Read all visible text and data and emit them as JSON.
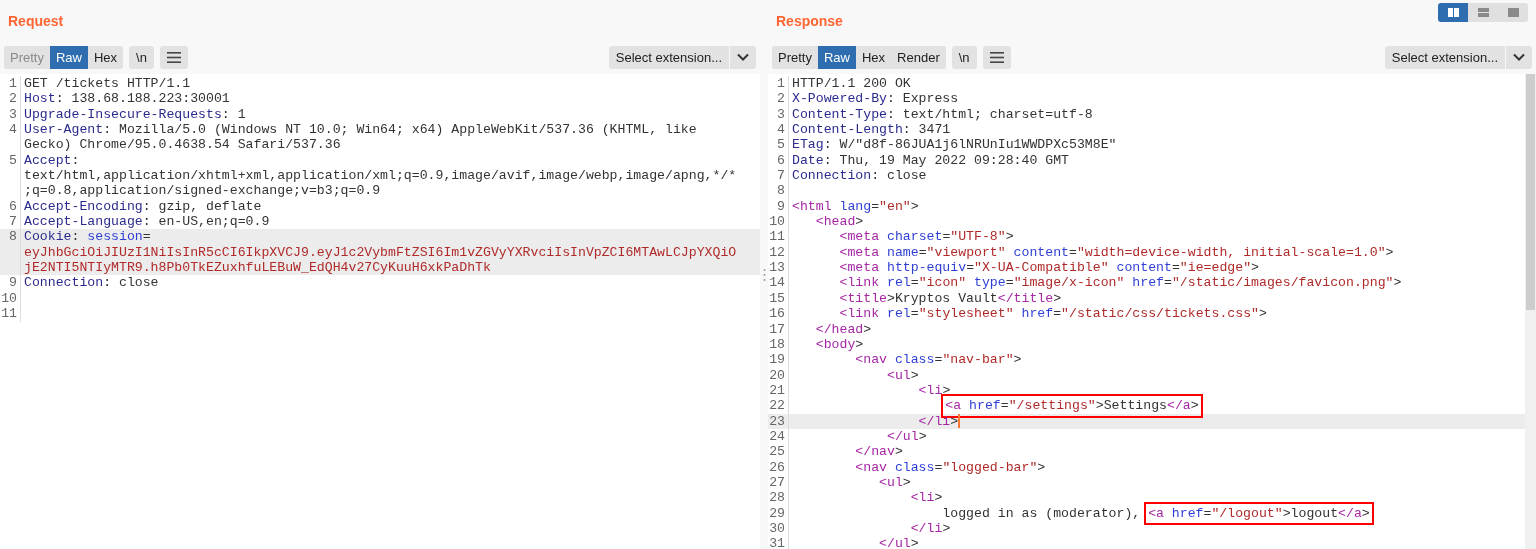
{
  "layout_buttons": [
    {
      "kind": "side-by-side",
      "selected": true
    },
    {
      "kind": "stacked",
      "selected": false
    },
    {
      "kind": "single",
      "selected": false
    }
  ],
  "panes": [
    {
      "title": "Request",
      "tabs": [
        {
          "label": "Pretty",
          "selected": false,
          "disabled": true
        },
        {
          "label": "Raw",
          "selected": true,
          "disabled": false
        },
        {
          "label": "Hex",
          "selected": false,
          "disabled": false
        }
      ],
      "newline_button": "\\n",
      "extension_select": "Select extension...",
      "scrollbar": false,
      "lines": [
        {
          "number": "1",
          "rows": [
            [
              {
                "kind": "text",
                "text": "GET /tickets HTTP/1.1"
              }
            ]
          ]
        },
        {
          "number": "2",
          "rows": [
            [
              {
                "kind": "name",
                "text": "Host"
              },
              {
                "kind": "text",
                "text": ": 138.68.188.223:30001"
              }
            ]
          ]
        },
        {
          "number": "3",
          "rows": [
            [
              {
                "kind": "name",
                "text": "Upgrade-Insecure-Requests"
              },
              {
                "kind": "text",
                "text": ": 1"
              }
            ]
          ]
        },
        {
          "number": "4",
          "rows": [
            [
              {
                "kind": "name",
                "text": "User-Agent"
              },
              {
                "kind": "text",
                "text": ": Mozilla/5.0 (Windows NT 10.0; Win64; x64) AppleWebKit/537.36 (KHTML, like"
              }
            ],
            [
              {
                "kind": "text",
                "text": "Gecko) Chrome/95.0.4638.54 Safari/537.36"
              }
            ]
          ]
        },
        {
          "number": "5",
          "rows": [
            [
              {
                "kind": "name",
                "text": "Accept"
              },
              {
                "kind": "text",
                "text": ":"
              }
            ],
            [
              {
                "kind": "text",
                "text": "text/html,application/xhtml+xml,application/xml;q=0.9,image/avif,image/webp,image/apng,*/*"
              }
            ],
            [
              {
                "kind": "text",
                "text": ";q=0.8,application/signed-exchange;v=b3;q=0.9"
              }
            ]
          ]
        },
        {
          "number": "6",
          "rows": [
            [
              {
                "kind": "name",
                "text": "Accept-Encoding"
              },
              {
                "kind": "text",
                "text": ": gzip, deflate"
              }
            ]
          ]
        },
        {
          "number": "7",
          "rows": [
            [
              {
                "kind": "name",
                "text": "Accept-Language"
              },
              {
                "kind": "text",
                "text": ": en-US,en;q=0.9"
              }
            ]
          ]
        },
        {
          "number": "8",
          "highlighted": true,
          "rows": [
            [
              {
                "kind": "name",
                "text": "Cookie"
              },
              {
                "kind": "text",
                "text": ":"
              },
              {
                "kind": "attr",
                "text": " session"
              },
              {
                "kind": "text",
                "text": "="
              }
            ],
            [
              {
                "kind": "string",
                "text": "eyJhbGciOiJIUzI1NiIsInR5cCI6IkpXVCJ9.eyJ1c2VybmFtZSI6Im1vZGVyYXRvciIsInVpZCI6MTAwLCJpYXQiO"
              }
            ],
            [
              {
                "kind": "string",
                "text": "jE2NTI5NTIyMTR9.h8Pb0TkEZuxhfuLEBuW_EdQH4v27CyKuuH6xkPaDhTk"
              }
            ]
          ]
        },
        {
          "number": "9",
          "rows": [
            [
              {
                "kind": "name",
                "text": "Connection"
              },
              {
                "kind": "text",
                "text": ": close"
              }
            ]
          ]
        },
        {
          "number": "10"
        },
        {
          "number": "11"
        }
      ]
    },
    {
      "title": "Response",
      "tabs": [
        {
          "label": "Pretty",
          "selected": false,
          "disabled": false
        },
        {
          "label": "Raw",
          "selected": true,
          "disabled": false
        },
        {
          "label": "Hex",
          "selected": false,
          "disabled": false
        },
        {
          "label": "Render",
          "selected": false,
          "disabled": false
        }
      ],
      "newline_button": "\\n",
      "extension_select": "Select extension...",
      "scrollbar": true,
      "lines": [
        {
          "number": "1",
          "rows": [
            [
              {
                "kind": "text",
                "text": "HTTP/1.1 200 OK"
              }
            ]
          ]
        },
        {
          "number": "2",
          "rows": [
            [
              {
                "kind": "name",
                "text": "X-Powered-By"
              },
              {
                "kind": "text",
                "text": ": Express"
              }
            ]
          ]
        },
        {
          "number": "3",
          "rows": [
            [
              {
                "kind": "name",
                "text": "Content-Type"
              },
              {
                "kind": "text",
                "text": ": text/html; charset=utf-8"
              }
            ]
          ]
        },
        {
          "number": "4",
          "rows": [
            [
              {
                "kind": "name",
                "text": "Content-Length"
              },
              {
                "kind": "text",
                "text": ": 3471"
              }
            ]
          ]
        },
        {
          "number": "5",
          "rows": [
            [
              {
                "kind": "name",
                "text": "ETag"
              },
              {
                "kind": "text",
                "text": ": W/\"d8f-86JUA1j6lNRUnIu1WWDPXc53M8E\""
              }
            ]
          ]
        },
        {
          "number": "6",
          "rows": [
            [
              {
                "kind": "name",
                "text": "Date"
              },
              {
                "kind": "text",
                "text": ": Thu, 19 May 2022 09:28:40 GMT"
              }
            ]
          ]
        },
        {
          "number": "7",
          "rows": [
            [
              {
                "kind": "name",
                "text": "Connection"
              },
              {
                "kind": "text",
                "text": ": close"
              }
            ]
          ]
        },
        {
          "number": "8"
        },
        {
          "number": "9",
          "rows": [
            [
              {
                "kind": "tag",
                "text": "<html"
              },
              {
                "kind": "attr",
                "text": " lang"
              },
              {
                "kind": "text",
                "text": "="
              },
              {
                "kind": "string",
                "text": "\"en\""
              },
              {
                "kind": "text",
                "text": ">"
              }
            ]
          ]
        },
        {
          "number": "10",
          "rows": [
            [
              {
                "kind": "tag",
                "text": "   <head"
              },
              {
                "kind": "text",
                "text": ">"
              }
            ]
          ]
        },
        {
          "number": "11",
          "rows": [
            [
              {
                "kind": "tag",
                "text": "      <meta"
              },
              {
                "kind": "attr",
                "text": " charset"
              },
              {
                "kind": "text",
                "text": "="
              },
              {
                "kind": "string",
                "text": "\"UTF-8\""
              },
              {
                "kind": "text",
                "text": ">"
              }
            ]
          ]
        },
        {
          "number": "12",
          "rows": [
            [
              {
                "kind": "tag",
                "text": "      <meta"
              },
              {
                "kind": "attr",
                "text": " name"
              },
              {
                "kind": "text",
                "text": "="
              },
              {
                "kind": "string",
                "text": "\"viewport\""
              },
              {
                "kind": "attr",
                "text": " content"
              },
              {
                "kind": "text",
                "text": "="
              },
              {
                "kind": "string",
                "text": "\"width=device-width, initial-scale=1.0\""
              },
              {
                "kind": "text",
                "text": ">"
              }
            ]
          ]
        },
        {
          "number": "13",
          "rows": [
            [
              {
                "kind": "tag",
                "text": "      <meta"
              },
              {
                "kind": "attr",
                "text": " http-equiv"
              },
              {
                "kind": "text",
                "text": "="
              },
              {
                "kind": "string",
                "text": "\"X-UA-Compatible\""
              },
              {
                "kind": "attr",
                "text": " content"
              },
              {
                "kind": "text",
                "text": "="
              },
              {
                "kind": "string",
                "text": "\"ie=edge\""
              },
              {
                "kind": "text",
                "text": ">"
              }
            ]
          ]
        },
        {
          "number": "14",
          "rows": [
            [
              {
                "kind": "tag",
                "text": "      <link"
              },
              {
                "kind": "attr",
                "text": " rel"
              },
              {
                "kind": "text",
                "text": "="
              },
              {
                "kind": "string",
                "text": "\"icon\""
              },
              {
                "kind": "attr",
                "text": " type"
              },
              {
                "kind": "text",
                "text": "="
              },
              {
                "kind": "string",
                "text": "\"image/x-icon\""
              },
              {
                "kind": "attr",
                "text": " href"
              },
              {
                "kind": "text",
                "text": "="
              },
              {
                "kind": "string",
                "text": "\"/static/images/favicon.png\""
              },
              {
                "kind": "text",
                "text": ">"
              }
            ]
          ]
        },
        {
          "number": "15",
          "rows": [
            [
              {
                "kind": "tag",
                "text": "      <title"
              },
              {
                "kind": "text",
                "text": ">Kryptos Vault"
              },
              {
                "kind": "tag",
                "text": "</title"
              },
              {
                "kind": "text",
                "text": ">"
              }
            ]
          ]
        },
        {
          "number": "16",
          "rows": [
            [
              {
                "kind": "tag",
                "text": "      <link"
              },
              {
                "kind": "attr",
                "text": " rel"
              },
              {
                "kind": "text",
                "text": "="
              },
              {
                "kind": "string",
                "text": "\"stylesheet\""
              },
              {
                "kind": "attr",
                "text": " href"
              },
              {
                "kind": "text",
                "text": "="
              },
              {
                "kind": "string",
                "text": "\"/static/css/tickets.css\""
              },
              {
                "kind": "text",
                "text": ">"
              }
            ]
          ]
        },
        {
          "number": "17",
          "rows": [
            [
              {
                "kind": "tag",
                "text": "   </head"
              },
              {
                "kind": "text",
                "text": ">"
              }
            ]
          ]
        },
        {
          "number": "18",
          "rows": [
            [
              {
                "kind": "tag",
                "text": "   <body"
              },
              {
                "kind": "text",
                "text": ">"
              }
            ]
          ]
        },
        {
          "number": "19",
          "rows": [
            [
              {
                "kind": "tag",
                "text": "        <nav"
              },
              {
                "kind": "attr",
                "text": " class"
              },
              {
                "kind": "text",
                "text": "="
              },
              {
                "kind": "string",
                "text": "\"nav-bar\""
              },
              {
                "kind": "text",
                "text": ">"
              }
            ]
          ]
        },
        {
          "number": "20",
          "rows": [
            [
              {
                "kind": "tag",
                "text": "            <ul"
              },
              {
                "kind": "text",
                "text": ">"
              }
            ]
          ]
        },
        {
          "number": "21",
          "rows": [
            [
              {
                "kind": "tag",
                "text": "                <li"
              },
              {
                "kind": "text",
                "text": ">"
              }
            ]
          ]
        },
        {
          "number": "22",
          "callout": [
            {
              "kind": "tag",
              "text": "<a"
            },
            {
              "kind": "attr",
              "text": " href"
            },
            {
              "kind": "text",
              "text": "="
            },
            {
              "kind": "string",
              "text": "\"/settings\""
            },
            {
              "kind": "text",
              "text": ">Settings"
            },
            {
              "kind": "tag",
              "text": "</a"
            },
            {
              "kind": "text",
              "text": ">"
            }
          ]
        },
        {
          "number": "23",
          "highlighted": true,
          "caret": true,
          "rows": [
            [
              {
                "kind": "tag",
                "text": "                </li"
              },
              {
                "kind": "text",
                "text": ">"
              }
            ]
          ]
        },
        {
          "number": "24",
          "rows": [
            [
              {
                "kind": "tag",
                "text": "            </ul"
              },
              {
                "kind": "text",
                "text": ">"
              }
            ]
          ]
        },
        {
          "number": "25",
          "rows": [
            [
              {
                "kind": "tag",
                "text": "        </nav"
              },
              {
                "kind": "text",
                "text": ">"
              }
            ]
          ]
        },
        {
          "number": "26",
          "rows": [
            [
              {
                "kind": "tag",
                "text": "        <nav"
              },
              {
                "kind": "attr",
                "text": " class"
              },
              {
                "kind": "text",
                "text": "="
              },
              {
                "kind": "string",
                "text": "\"logged-bar\""
              },
              {
                "kind": "text",
                "text": ">"
              }
            ]
          ]
        },
        {
          "number": "27",
          "rows": [
            [
              {
                "kind": "tag",
                "text": "           <ul"
              },
              {
                "kind": "text",
                "text": ">"
              }
            ]
          ]
        },
        {
          "number": "28",
          "rows": [
            [
              {
                "kind": "tag",
                "text": "               <li"
              },
              {
                "kind": "text",
                "text": ">"
              }
            ]
          ]
        },
        {
          "number": "29",
          "rows": [
            [
              {
                "kind": "text",
                "text": "                   logged in as (moderator),"
              }
            ]
          ],
          "callout": [
            {
              "kind": "tag",
              "text": "<a"
            },
            {
              "kind": "attr",
              "text": " href"
            },
            {
              "kind": "text",
              "text": "="
            },
            {
              "kind": "string",
              "text": "\"/logout\""
            },
            {
              "kind": "text",
              "text": ">logout"
            },
            {
              "kind": "tag",
              "text": "</a"
            },
            {
              "kind": "text",
              "text": ">"
            }
          ]
        },
        {
          "number": "30",
          "rows": [
            [
              {
                "kind": "tag",
                "text": "               </li"
              },
              {
                "kind": "text",
                "text": ">"
              }
            ]
          ]
        },
        {
          "number": "31",
          "rows": [
            [
              {
                "kind": "tag",
                "text": "           </ul"
              },
              {
                "kind": "text",
                "text": ">"
              }
            ]
          ]
        }
      ]
    }
  ]
}
